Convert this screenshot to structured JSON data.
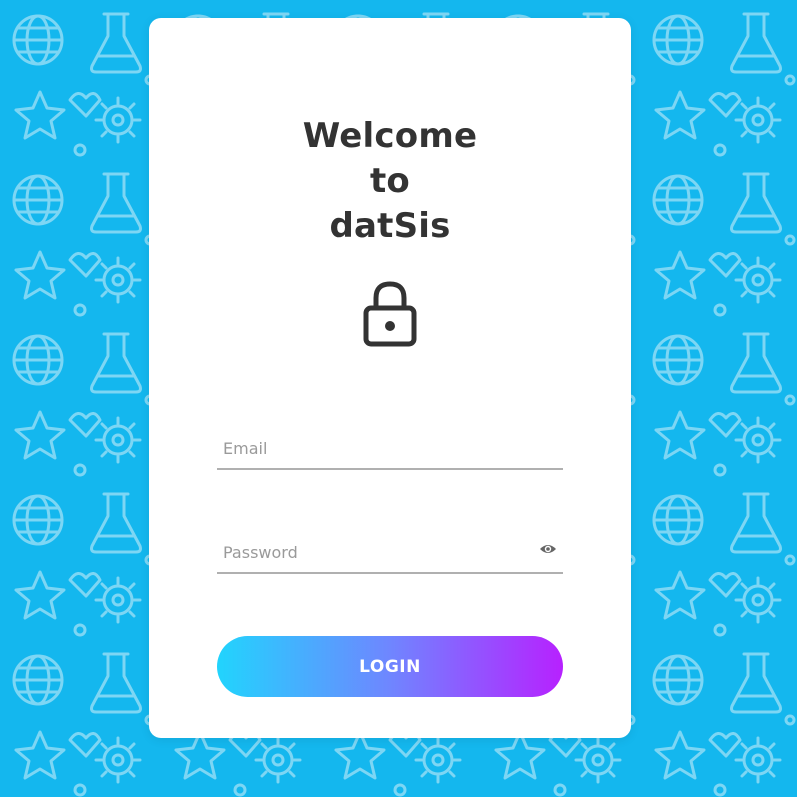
{
  "login_card": {
    "title_lines": [
      "Welcome",
      "to",
      "datSis"
    ],
    "lock_icon": "lock-icon",
    "email": {
      "placeholder": "Email",
      "value": ""
    },
    "password": {
      "placeholder": "Password",
      "value": "",
      "toggle_icon": "eye-icon"
    },
    "login_button_label": "LOGIN"
  },
  "colors": {
    "background": "#14b7ee",
    "card": "#ffffff",
    "title_text": "#333333",
    "gradient_start": "#21d4fd",
    "gradient_end": "#b721ff",
    "underline": "#b0b0b0"
  }
}
